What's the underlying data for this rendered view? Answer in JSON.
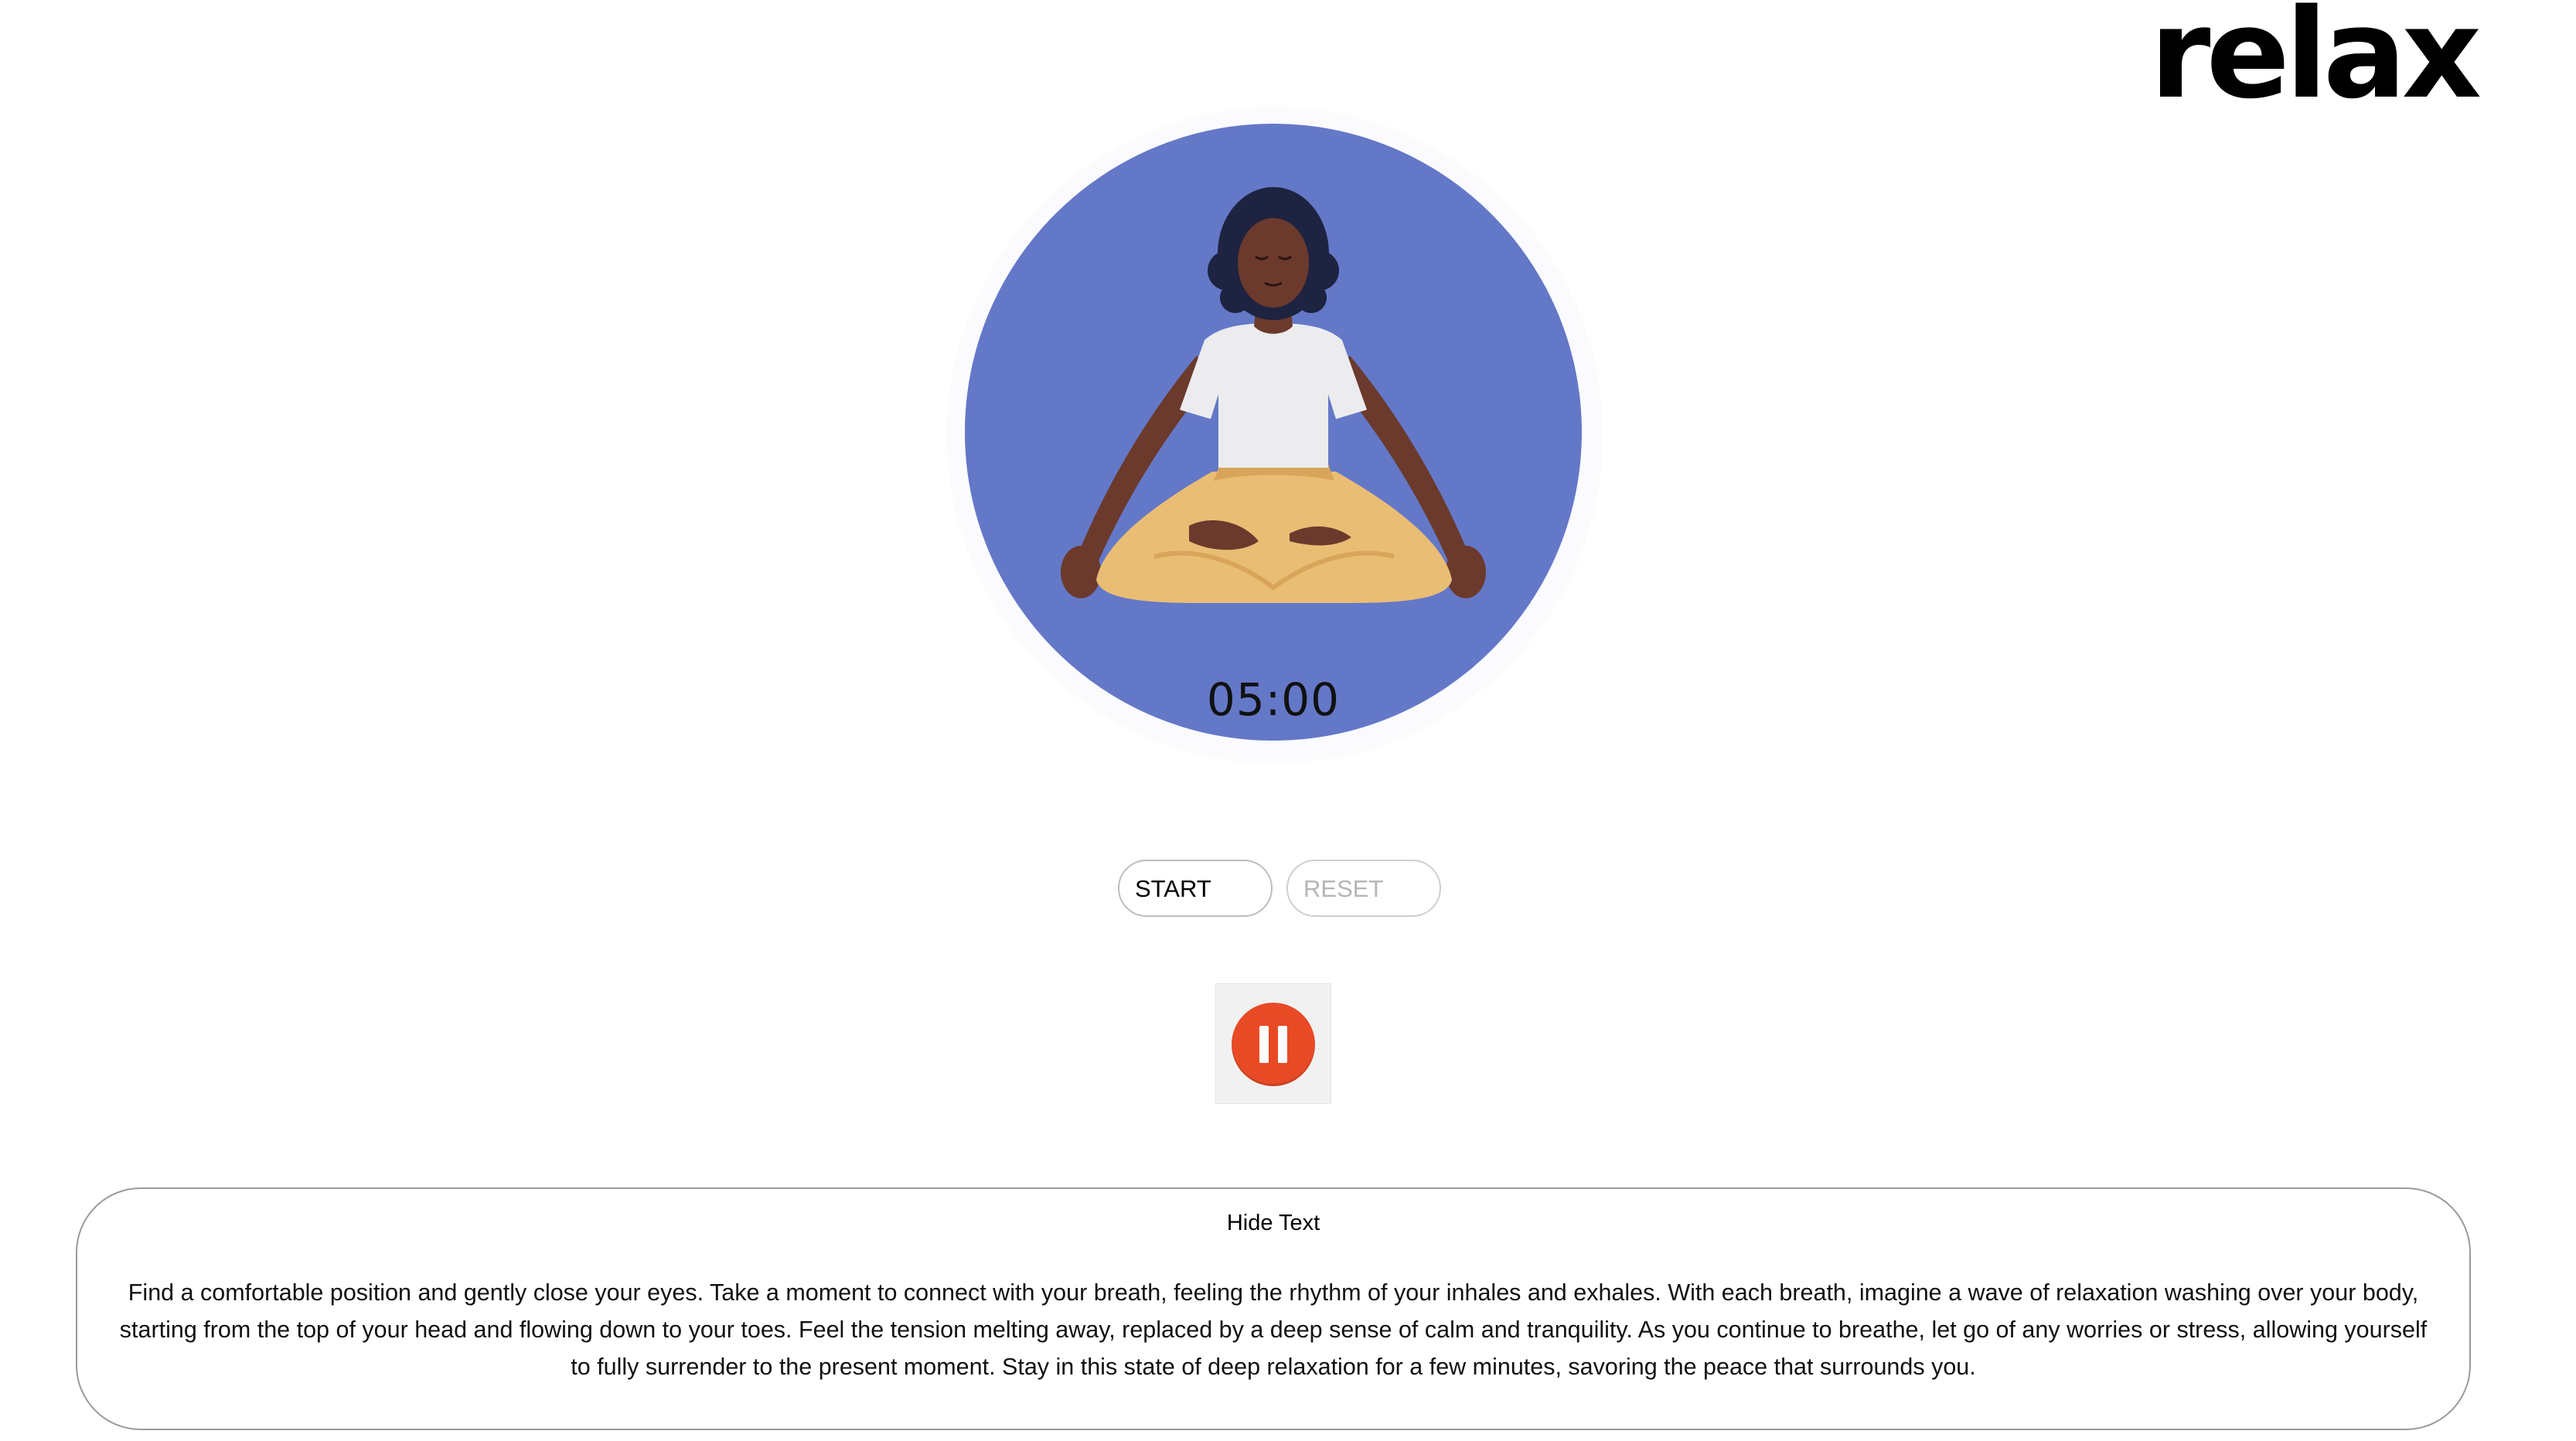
{
  "brand": {
    "logo_text": "relax"
  },
  "meditation": {
    "illustration": "meditating-woman-illustration",
    "timer": "05:00"
  },
  "controls": {
    "start_label": "START",
    "reset_label": "RESET"
  },
  "audio": {
    "state": "playing",
    "icon": "pause-icon",
    "accent": "#e84a26"
  },
  "text_panel": {
    "toggle_label": "Hide Text",
    "body": "Find a comfortable position and gently close your eyes. Take a moment to connect with your breath, feeling the rhythm of your inhales and exhales. With each breath, imagine a wave of relaxation washing over your body, starting from the top of your head and flowing down to your toes. Feel the tension melting away, replaced by a deep sense of calm and tranquility. As you continue to breathe, let go of any worries or stress, allowing yourself to fully surrender to the present moment. Stay in this state of deep relaxation for a few minutes, savoring the peace that surrounds you."
  },
  "colors": {
    "circle": "#6478c8",
    "skin": "#6b3a2c",
    "shirt": "#ececef",
    "pants": "#e9bd74",
    "hair": "#1d2340"
  }
}
